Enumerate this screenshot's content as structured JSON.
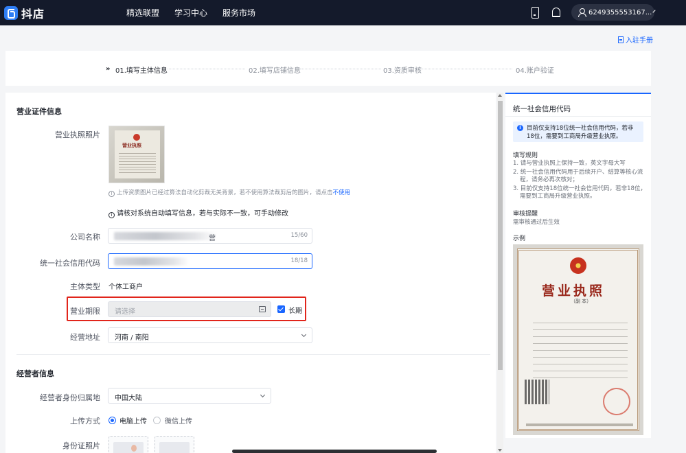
{
  "header": {
    "logo_text": "抖店",
    "nav": [
      "精选联盟",
      "学习中心",
      "服务市场"
    ],
    "user_id": "6249355553167..."
  },
  "manual_link": "入驻手册",
  "steps": [
    {
      "label": "01.填写主体信息",
      "active": true
    },
    {
      "label": "02.填写店铺信息",
      "active": false
    },
    {
      "label": "03.资质审核",
      "active": false
    },
    {
      "label": "04.账户验证",
      "active": false
    }
  ],
  "business_section": {
    "title": "营业证件信息",
    "license_photo_label": "营业执照照片",
    "thumb_title": "营业执照",
    "upload_hint": "上传资质图片已经过算法自动化剪裁无关背景，若不使用算法裁剪后的图片，请点击",
    "upload_hint_link": "不使用",
    "notice": "请核对系统自动填写信息，若与实际不一致，可手动修改",
    "company_name_label": "公司名称",
    "company_name_tail": "营",
    "company_name_counter": "15/60",
    "credit_code_label": "统一社会信用代码",
    "credit_code_counter": "18/18",
    "entity_type_label": "主体类型",
    "entity_type_value": "个体工商户",
    "term_label": "营业期限",
    "term_placeholder": "请选择",
    "long_term_label": "长期",
    "long_term_checked": true,
    "address_label": "经营地址",
    "address_value": "河南 / 南阳"
  },
  "operator_section": {
    "title": "经营者信息",
    "id_region_label": "经营者身份归属地",
    "id_region_value": "中国大陆",
    "upload_method_label": "上传方式",
    "upload_options": [
      "电脑上传",
      "微信上传"
    ],
    "upload_selected": "电脑上传",
    "id_photo_label": "身份证照片"
  },
  "side_panel": {
    "title": "统一社会信用代码",
    "tip": "目前仅支持18位统一社会信用代码，若非18位，需要到工商局升级营业执照。",
    "rules_title": "填写规则",
    "rules": [
      "1. 请与营业执照上保持一致，英文字母大写",
      "2. 统一社会信用代码用于后续开户、结算等核心流",
      "   程，请务必再次核对；",
      "3. 目前仅支持18位统一社会信用代码，若非18位，",
      "   需要到工商局升级营业执照。"
    ],
    "review_title": "审核提醒",
    "review_text": "需审核通过后生效",
    "example_title": "示例",
    "sample_title": "营业执照",
    "sample_sub": "（副 本）"
  },
  "colors": {
    "accent": "#1966ff",
    "topbar": "#141a2b",
    "highlight": "#e1251b"
  }
}
